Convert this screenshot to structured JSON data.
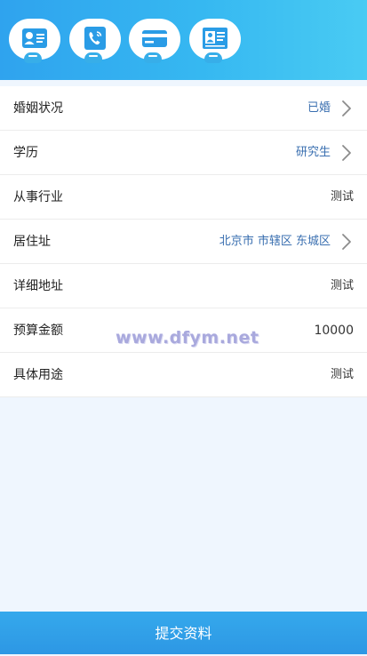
{
  "header": {
    "steps": [
      {
        "icon": "id-card-icon"
      },
      {
        "icon": "phone-contact-icon"
      },
      {
        "icon": "bank-card-icon"
      },
      {
        "icon": "profile-card-icon"
      }
    ],
    "colors": {
      "start": "#2fa3ee",
      "end": "#49cbf3"
    }
  },
  "form": {
    "rows": [
      {
        "label": "婚姻状况",
        "value": "已婚",
        "selectable": true
      },
      {
        "label": "学历",
        "value": "研究生",
        "selectable": true
      },
      {
        "label": "从事行业",
        "value": "测试",
        "selectable": false
      },
      {
        "label": "居住址",
        "value": "北京市 市辖区 东城区",
        "selectable": true
      },
      {
        "label": "详细地址",
        "value": "测试",
        "selectable": false
      },
      {
        "label": "预算金额",
        "value": "10000",
        "selectable": false
      },
      {
        "label": "具体用途",
        "value": "测试",
        "selectable": false
      }
    ]
  },
  "watermark": "www.dfym.net",
  "footer": {
    "submit_label": "提交资料"
  }
}
